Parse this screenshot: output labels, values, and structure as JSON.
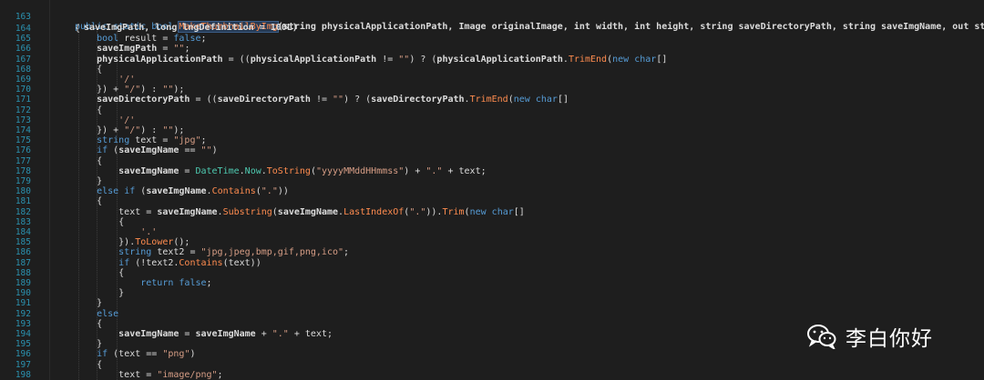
{
  "signature": {
    "line_number": "163",
    "modifiers": "public static bool ",
    "method_name": "MakeThumbnailByImg",
    "params": "(string physicalApplicationPath, Image originalImage, int width, int height, string saveDirectoryPath, string saveImgName, out string",
    "params_cont": "saveImgPath, long lngDefinition = 100L)"
  },
  "lines": [
    {
      "n": "164",
      "t": "{"
    },
    {
      "n": "165",
      "t": "    bool result = false;"
    },
    {
      "n": "166",
      "t": "    saveImgPath = \"\";"
    },
    {
      "n": "167",
      "t": "    physicalApplicationPath = ((physicalApplicationPath != \"\") ? (physicalApplicationPath.TrimEnd(new char[]"
    },
    {
      "n": "168",
      "t": "    {"
    },
    {
      "n": "169",
      "t": "        '/'"
    },
    {
      "n": "170",
      "t": "    }) + \"/\") : \"\");"
    },
    {
      "n": "171",
      "t": "    saveDirectoryPath = ((saveDirectoryPath != \"\") ? (saveDirectoryPath.TrimEnd(new char[]"
    },
    {
      "n": "172",
      "t": "    {"
    },
    {
      "n": "173",
      "t": "        '/'"
    },
    {
      "n": "174",
      "t": "    }) + \"/\") : \"\");"
    },
    {
      "n": "175",
      "t": "    string text = \"jpg\";"
    },
    {
      "n": "176",
      "t": "    if (saveImgName == \"\")"
    },
    {
      "n": "177",
      "t": "    {"
    },
    {
      "n": "178",
      "t": "        saveImgName = DateTime.Now.ToString(\"yyyyMMddHHmmss\") + \".\" + text;"
    },
    {
      "n": "179",
      "t": "    }"
    },
    {
      "n": "180",
      "t": "    else if (saveImgName.Contains(\".\"))"
    },
    {
      "n": "181",
      "t": "    {"
    },
    {
      "n": "182",
      "t": "        text = saveImgName.Substring(saveImgName.LastIndexOf(\".\")).Trim(new char[]"
    },
    {
      "n": "183",
      "t": "        {"
    },
    {
      "n": "184",
      "t": "            '.'"
    },
    {
      "n": "185",
      "t": "        }).ToLower();"
    },
    {
      "n": "186",
      "t": "        string text2 = \"jpg,jpeg,bmp,gif,png,ico\";"
    },
    {
      "n": "187",
      "t": "        if (!text2.Contains(text))"
    },
    {
      "n": "188",
      "t": "        {"
    },
    {
      "n": "189",
      "t": "            return false;"
    },
    {
      "n": "190",
      "t": "        }"
    },
    {
      "n": "191",
      "t": "    }"
    },
    {
      "n": "192",
      "t": "    else"
    },
    {
      "n": "193",
      "t": "    {"
    },
    {
      "n": "194",
      "t": "        saveImgName = saveImgName + \".\" + text;"
    },
    {
      "n": "195",
      "t": "    }"
    },
    {
      "n": "196",
      "t": "    if (text == \"png\")"
    },
    {
      "n": "197",
      "t": "    {"
    },
    {
      "n": "198",
      "t": "        text = \"image/png\";"
    }
  ],
  "watermark": {
    "text": "李白你好",
    "icon": "wechat-icon"
  },
  "colors": {
    "background": "#1e1e1e",
    "keyword": "#569cd6",
    "type": "#4ec9b0",
    "string": "#d69d85",
    "method": "#ff8c4f",
    "line_number": "#2b91af"
  }
}
